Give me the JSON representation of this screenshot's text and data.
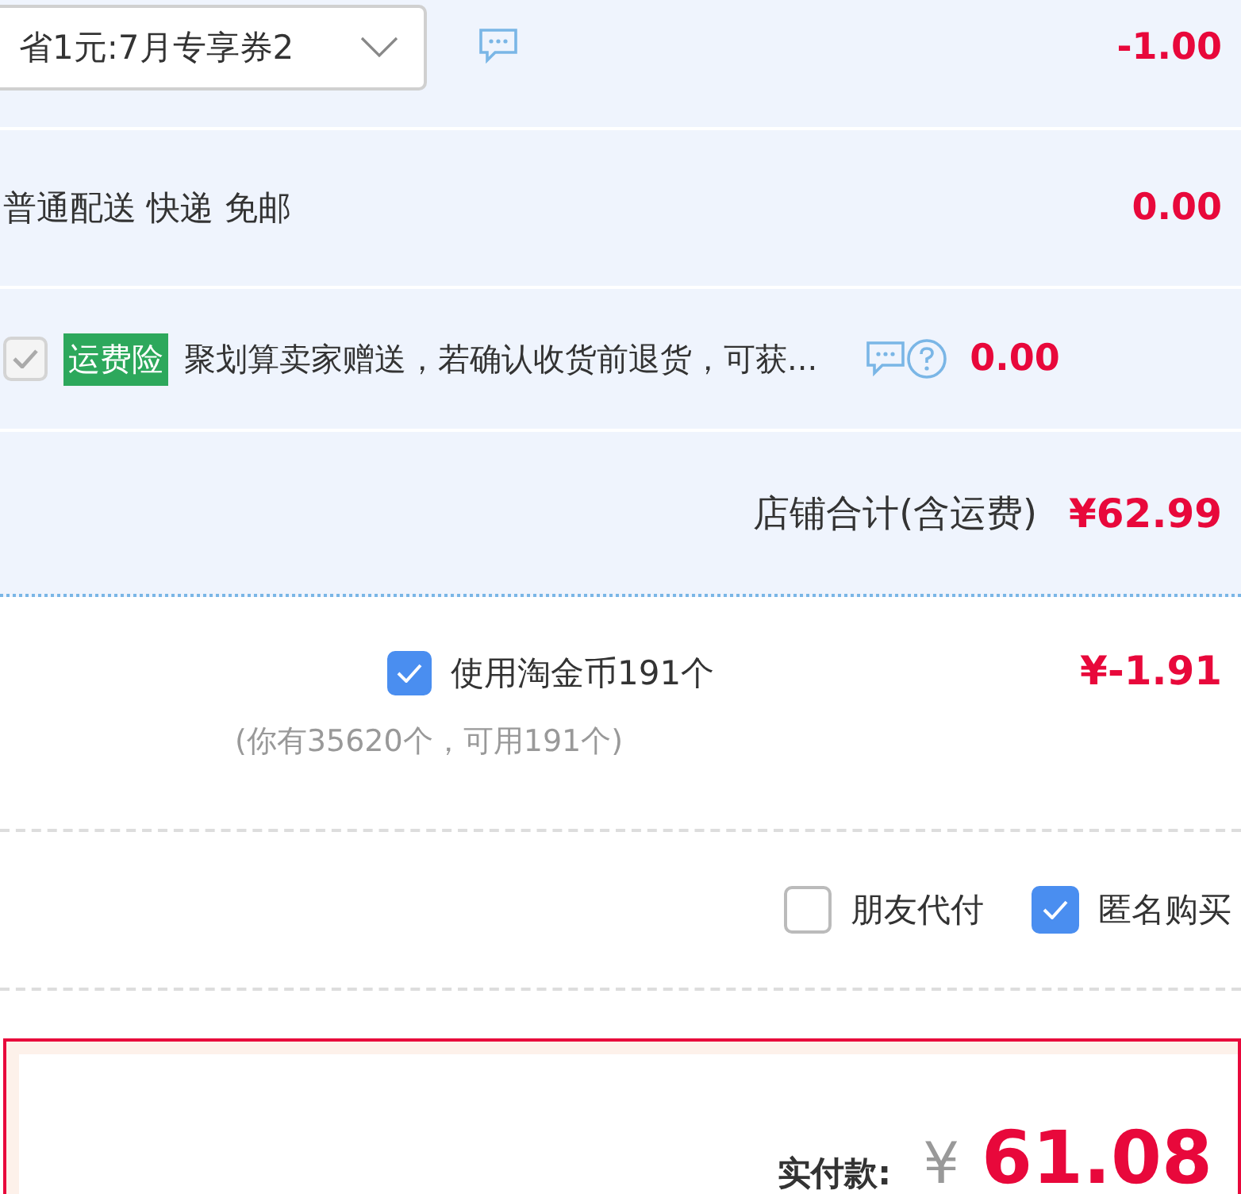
{
  "coupon": {
    "value": "省1元:7月专享券2",
    "amount": "-1.00"
  },
  "shipping": {
    "text": "普通配送 快递 免邮",
    "amount": "0.00"
  },
  "insurance": {
    "checked": true,
    "disabled": true,
    "tag": "运费险",
    "text": "聚划算卖家赠送，若确认收货前退货，可获...",
    "amount": "0.00"
  },
  "shop_total": {
    "label": "店铺合计(含运费)",
    "amount": "¥62.99"
  },
  "coins": {
    "checked": true,
    "label": "使用淘金币191个",
    "note": "(你有35620个，可用191个)",
    "amount": "¥-1.91"
  },
  "options": [
    {
      "label": "朋友代付",
      "checked": false
    },
    {
      "label": "匿名购买",
      "checked": true
    }
  ],
  "payment": {
    "label": "实付款:",
    "currency": "¥",
    "amount": "61.08"
  }
}
